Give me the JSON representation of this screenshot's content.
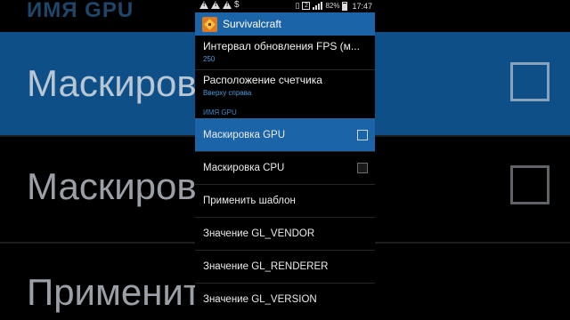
{
  "status_bar": {
    "battery": "82%",
    "time": "17:47",
    "left_icons": [
      "warning-icon",
      "warning-icon",
      "warning-icon",
      "dollar-icon"
    ],
    "right_icons": [
      "vibrate-icon",
      "notification-badge-icon",
      "signal-icon",
      "battery-icon"
    ],
    "badge": "2"
  },
  "action_bar": {
    "title": "Survivalcraft",
    "icon": "app-icon"
  },
  "prefs": [
    {
      "title": "Интервал обновления FPS (м...",
      "summary": "250"
    },
    {
      "title": "Расположение счетчика",
      "summary": "Вверху справа"
    }
  ],
  "section_header": "ИМЯ GPU",
  "rows": [
    {
      "label": "Маскировка GPU",
      "checkbox": true,
      "checked": false,
      "highlighted": true
    },
    {
      "label": "Маскировка CPU",
      "checkbox": true,
      "checked": false,
      "highlighted": false
    },
    {
      "label": "Применить шаблон",
      "checkbox": false
    },
    {
      "label": "Значение GL_VENDOR",
      "checkbox": false
    },
    {
      "label": "Значение GL_RENDERER",
      "checkbox": false
    },
    {
      "label": "Значение GL_VERSION",
      "checkbox": false
    }
  ],
  "backdrop": {
    "section": "ИМЯ GPU",
    "rows": [
      "Маскировка GPU",
      "Маскировка CPU",
      "Применить шаблон"
    ]
  },
  "colors": {
    "accent": "#1c64a8",
    "section": "#3d86c6",
    "summary": "#4e9ad8",
    "background": "#000000"
  }
}
